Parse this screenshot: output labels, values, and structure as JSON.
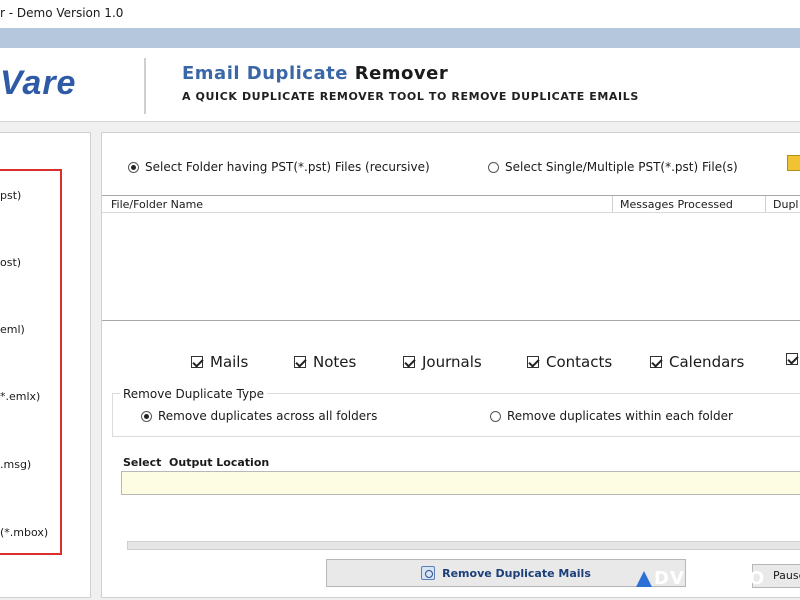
{
  "window": {
    "title": "r - Demo Version 1.0"
  },
  "header": {
    "logo_text": "Vare",
    "title_part1": "Email Duplicate",
    "title_part2": "Remover",
    "subtitle": "A QUICK DUPLICATE REMOVER TOOL TO REMOVE DUPLICATE EMAILS"
  },
  "left_panel": {
    "formats": [
      "pst)",
      "ost)",
      "eml)",
      "*.emlx)",
      ".msg)",
      "(*.mbox)"
    ]
  },
  "source": {
    "options": [
      {
        "label": "Select Folder having PST(*.pst) Files (recursive)",
        "selected": true
      },
      {
        "label": "Select Single/Multiple PST(*.pst) File(s)",
        "selected": false
      }
    ]
  },
  "grid": {
    "columns": [
      "File/Folder Name",
      "Messages Processed",
      "Dupl"
    ]
  },
  "categories": [
    "Mails",
    "Notes",
    "Journals",
    "Contacts",
    "Calendars"
  ],
  "remove_type": {
    "legend": "Remove Duplicate Type",
    "options": [
      {
        "label": "Remove duplicates across all folders",
        "selected": true
      },
      {
        "label": "Remove duplicates within each folder",
        "selected": false
      }
    ]
  },
  "output": {
    "label": "Select  Output Location",
    "value": ""
  },
  "buttons": {
    "remove": "Remove Duplicate Mails",
    "pause": "Pause"
  },
  "watermark": "DVERTIGO",
  "colors": {
    "accent": "#3a67a8",
    "title_band": "#b4c7dc",
    "highlight_box": "#d9302c",
    "output_field": "#fdfde4"
  }
}
